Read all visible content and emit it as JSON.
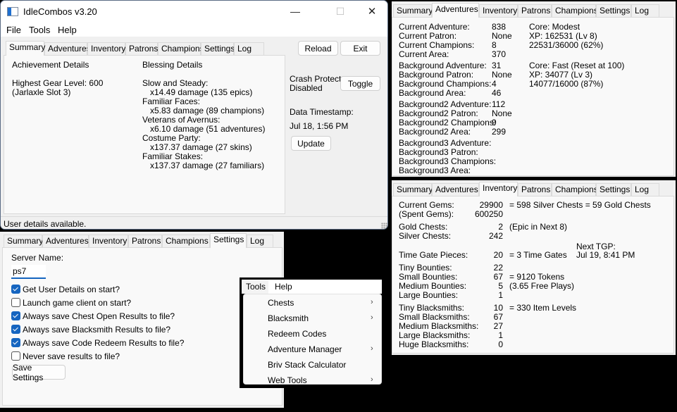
{
  "main_window": {
    "title": "IdleCombos v3.20",
    "controls": {
      "minimize": "—",
      "maximize": "☐",
      "close": "✕"
    },
    "menu": [
      "File",
      "Tools",
      "Help"
    ],
    "tabs": [
      "Summary",
      "Adventures",
      "Inventory",
      "Patrons",
      "Champions",
      "Settings",
      "Log"
    ],
    "active_tab": "Summary",
    "buttons": {
      "reload": "Reload",
      "exit": "Exit",
      "toggle": "Toggle",
      "update": "Update"
    },
    "summary": {
      "achievement_heading": "Achievement Details",
      "achievement_lines": [
        "Highest Gear Level: 600",
        "(Jarlaxle Slot 3)"
      ],
      "blessing_heading": "Blessing Details",
      "blessings": [
        {
          "name": "Slow and Steady:",
          "detail": "x14.49 damage (135 epics)"
        },
        {
          "name": "Familiar Faces:",
          "detail": "x5.83 damage (89 champions)"
        },
        {
          "name": "Veterans of Avernus:",
          "detail": "x6.10 damage (51 adventures)"
        },
        {
          "name": "Costume Party:",
          "detail": "x137.37 damage (27 skins)"
        },
        {
          "name": "Familiar Stakes:",
          "detail": "x137.37 damage (27 familiars)"
        }
      ]
    },
    "side": {
      "crash_protect": [
        "Crash Protect",
        "Disabled"
      ],
      "timestamp_label": "Data Timestamp:",
      "timestamp_value": "Jul 18, 1:56 PM"
    },
    "status": "User details available."
  },
  "settings_window": {
    "tabs": [
      "Summary",
      "Adventures",
      "Inventory",
      "Patrons",
      "Champions",
      "Settings",
      "Log"
    ],
    "active_tab": "Settings",
    "server_label": "Server Name:",
    "server_value": "ps7",
    "options": [
      {
        "label": "Get User Details on start?",
        "checked": true
      },
      {
        "label": "Launch game client on start?",
        "checked": false
      },
      {
        "label": "Always save Chest Open Results to file?",
        "checked": true
      },
      {
        "label": "Always save Blacksmith Results to file?",
        "checked": true
      },
      {
        "label": "Always save Code Redeem Results to file?",
        "checked": true
      },
      {
        "label": "Never save results to file?",
        "checked": false
      }
    ],
    "save_button": "Save Settings"
  },
  "tools_menu": {
    "menubar": [
      "Tools",
      "Help"
    ],
    "items": [
      {
        "label": "Chests",
        "submenu": true
      },
      {
        "label": "Blacksmith",
        "submenu": true
      },
      {
        "label": "Redeem Codes",
        "submenu": false
      },
      {
        "label": "Adventure Manager",
        "submenu": true
      },
      {
        "label": "Briv Stack Calculator",
        "submenu": false
      },
      {
        "label": "Web Tools",
        "submenu": true
      }
    ],
    "arrow_glyph": "›"
  },
  "adventures_window": {
    "tabs": [
      "Summary",
      "Adventures",
      "Inventory",
      "Patrons",
      "Champions",
      "Settings",
      "Log"
    ],
    "active_tab": "Adventures",
    "groups": [
      {
        "labels": [
          "Current Adventure:",
          "Current Patron:",
          "Current Champions:",
          "Current Area:"
        ],
        "values": [
          "838",
          "None",
          "8",
          "370"
        ],
        "notes": [
          "Core: Modest",
          "XP: 162531 (Lv 8)",
          "22531/36000 (62%)",
          ""
        ]
      },
      {
        "labels": [
          "Background Adventure:",
          "Background Patron:",
          "Background Champions:",
          "Background Area:"
        ],
        "values": [
          "31",
          "None",
          "4",
          "46"
        ],
        "notes": [
          "Core: Fast (Reset at 100)",
          "XP: 34077 (Lv 3)",
          "14077/16000 (87%)",
          ""
        ]
      },
      {
        "labels": [
          "Background2 Adventure:",
          "Background2 Patron:",
          "Background2 Champions:",
          "Background2 Area:"
        ],
        "values": [
          "112",
          "None",
          "9",
          "299"
        ],
        "notes": [
          "",
          "",
          "",
          ""
        ]
      },
      {
        "labels": [
          "Background3 Adventure:",
          "Background3 Patron:",
          "Background3 Champions:",
          "Background3 Area:"
        ],
        "values": [
          "",
          "",
          "",
          ""
        ],
        "notes": [
          "",
          "",
          "",
          ""
        ]
      }
    ]
  },
  "inventory_window": {
    "tabs": [
      "Summary",
      "Adventures",
      "Inventory",
      "Patrons",
      "Champions",
      "Settings",
      "Log"
    ],
    "active_tab": "Inventory",
    "gems": {
      "labels": [
        "Current Gems:",
        "(Spent Gems):"
      ],
      "values": [
        "29900",
        "600250"
      ],
      "note": "= 598 Silver Chests = 59 Gold Chests"
    },
    "chests": {
      "labels": [
        "Gold Chests:",
        "Silver Chests:"
      ],
      "values": [
        "2",
        "242"
      ],
      "note": "(Epic in Next 8)"
    },
    "time_gates": {
      "label": "Time Gate Pieces:",
      "value": "20",
      "note": "= 3 Time Gates",
      "next_label": "Next TGP:",
      "next_value": "Jul 19, 8:41 PM"
    },
    "bounties": {
      "labels": [
        "Tiny Bounties:",
        "Small Bounties:",
        "Medium Bounties:",
        "Large Bounties:"
      ],
      "values": [
        "22",
        "67",
        "5",
        "1"
      ],
      "notes": [
        "",
        "= 9120 Tokens",
        "(3.65 Free Plays)",
        ""
      ]
    },
    "blacksmiths": {
      "labels": [
        "Tiny Blacksmiths:",
        "Small Blacksmiths:",
        "Medium Blacksmiths:",
        "Large Blacksmiths:",
        "Huge Blacksmiths:"
      ],
      "values": [
        "10",
        "67",
        "27",
        "1",
        "0"
      ],
      "notes": [
        "= 330 Item Levels",
        "",
        "",
        "",
        ""
      ]
    }
  }
}
